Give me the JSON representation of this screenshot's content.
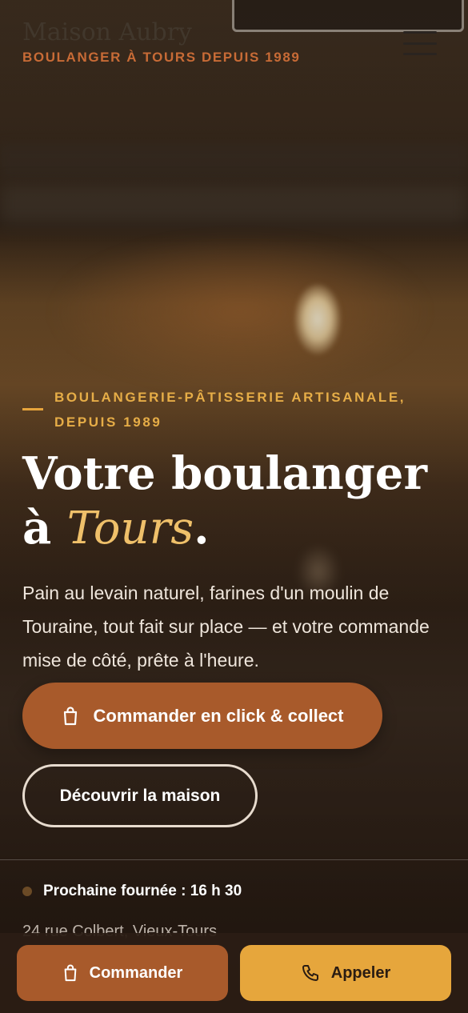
{
  "brand": {
    "name": "Maison Aubry",
    "tagline": "BOULANGER À TOURS DEPUIS 1989"
  },
  "hero": {
    "eyebrow_line1": "BOULANGERIE-PÂTISSERIE ARTISANALE,",
    "eyebrow_line2": "DEPUIS 1989",
    "title_line1": "Votre boulanger",
    "title_prefix": "à",
    "title_city": "Tours",
    "title_suffix": ".",
    "lead": "Pain au levain naturel, farines d'un moulin de Touraine, tout fait sur place — et votre commande mise de côté, prête à l'heure.",
    "cta_primary": "Commander en click & collect",
    "cta_secondary": "Découvrir la maison"
  },
  "info": {
    "next_batch": "Prochaine fournée : 16 h 30",
    "address": "24 rue Colbert, Vieux-Tours"
  },
  "bottom_bar": {
    "order_label": "Commander",
    "call_label": "Appeler"
  },
  "icons": {
    "menu": "hamburger-icon",
    "bag": "shopping-bag-icon",
    "phone": "phone-icon"
  },
  "colors": {
    "accent": "#a85a2b",
    "gold": "#e6a63c",
    "city": "#efc06a",
    "tagline": "#c86b36"
  }
}
